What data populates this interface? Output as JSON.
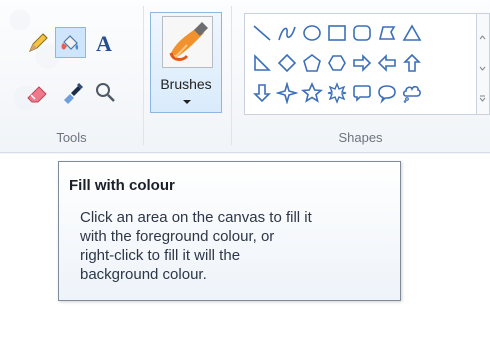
{
  "ribbon": {
    "groups": {
      "tools": {
        "label": "Tools"
      },
      "brushes": {
        "button_label": "Brushes"
      },
      "shapes": {
        "label": "Shapes"
      }
    },
    "tools": [
      {
        "name": "pencil-icon"
      },
      {
        "name": "fill-icon",
        "selected": true
      },
      {
        "name": "text-icon"
      },
      {
        "name": "eraser-icon"
      },
      {
        "name": "color-picker-icon"
      },
      {
        "name": "magnifier-icon"
      }
    ],
    "shape_rows": [
      [
        "line-shape",
        "curve-shape",
        "oval-shape",
        "rectangle-shape",
        "rounded-rectangle-shape",
        "polygon-shape",
        "triangle-shape"
      ],
      [
        "right-triangle-shape",
        "diamond-shape",
        "pentagon-shape",
        "hexagon-shape",
        "right-arrow-shape",
        "left-arrow-shape",
        "up-arrow-shape"
      ],
      [
        "down-arrow-shape",
        "four-point-star-shape",
        "five-point-star-shape",
        "six-point-star-shape",
        "rounded-rectangular-callout-shape",
        "oval-callout-shape",
        "cloud-callout-shape"
      ]
    ]
  },
  "tooltip": {
    "title": "Fill with colour",
    "lines": [
      "Click an area on the canvas to fill it",
      "with the foreground colour, or",
      "right-click to fill it will the",
      "background colour."
    ]
  },
  "colors": {
    "ribbon_bg": "#f3f6fa",
    "selected": "#cfe5fb",
    "shape_stroke": "#3d6fb8",
    "tooltip_border": "#7f8b99"
  }
}
